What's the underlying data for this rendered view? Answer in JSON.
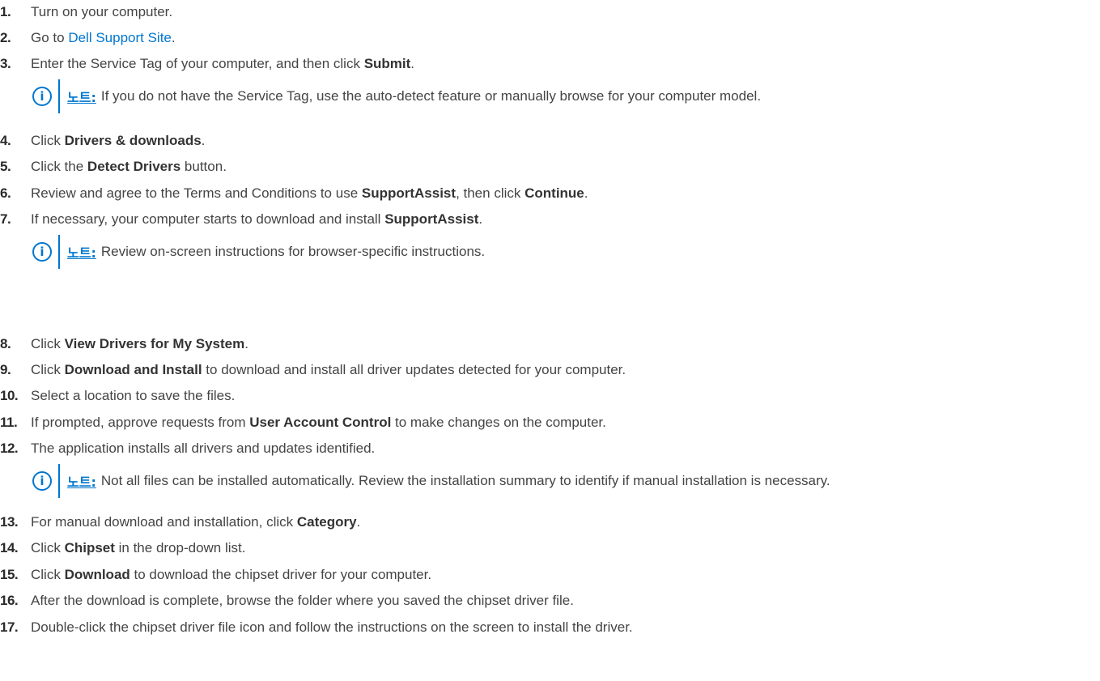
{
  "steps": {
    "s1": {
      "num": "1.",
      "text": "Turn on your computer."
    },
    "s2": {
      "num": "2.",
      "pre": "Go to ",
      "link": "Dell Support Site",
      "post": "."
    },
    "s3": {
      "num": "3.",
      "pre": "Enter the Service Tag of your computer, and then click ",
      "bold": "Submit",
      "post": "."
    },
    "s4": {
      "num": "4.",
      "pre": "Click ",
      "bold": "Drivers & downloads",
      "post": "."
    },
    "s5": {
      "num": "5.",
      "pre": "Click the ",
      "bold": "Detect Drivers",
      "post": " button."
    },
    "s6": {
      "num": "6.",
      "pre": "Review and agree to the Terms and Conditions to use ",
      "bold": "SupportAssist",
      "mid": ", then click ",
      "bold2": "Continue",
      "post": "."
    },
    "s7": {
      "num": "7.",
      "pre": "If necessary, your computer starts to download and install ",
      "bold": "SupportAssist",
      "post": "."
    },
    "s8": {
      "num": "8.",
      "pre": "Click ",
      "bold": "View Drivers for My System",
      "post": "."
    },
    "s9": {
      "num": "9.",
      "pre": "Click ",
      "bold": "Download and Install",
      "post": " to download and install all driver updates detected for your computer."
    },
    "s10": {
      "num": "10.",
      "text": "Select a location to save the files."
    },
    "s11": {
      "num": "11.",
      "pre": "If prompted, approve requests from ",
      "bold": "User Account Control",
      "post": " to make changes on the computer."
    },
    "s12": {
      "num": "12.",
      "text": "The application installs all drivers and updates identified."
    },
    "s13": {
      "num": "13.",
      "pre": "For manual download and installation, click ",
      "bold": "Category",
      "post": "."
    },
    "s14": {
      "num": "14.",
      "pre": "Click ",
      "bold": "Chipset",
      "post": " in the drop-down list."
    },
    "s15": {
      "num": "15.",
      "pre": "Click ",
      "bold": "Download",
      "post": " to download the chipset driver for your computer."
    },
    "s16": {
      "num": "16.",
      "text": "After the download is complete, browse the folder where you saved the chipset driver file."
    },
    "s17": {
      "num": "17.",
      "text": "Double-click the chipset driver file icon and follow the instructions on the screen to install the driver."
    }
  },
  "notes": {
    "label": "노트:",
    "n1": "If you do not have the Service Tag, use the auto-detect feature or manually browse for your computer model.",
    "n2": "Review on-screen instructions for browser-specific instructions.",
    "n3": "Not all files can be installed automatically. Review the installation summary to identify if manual installation is necessary."
  },
  "icons": {
    "note_icon": "info-circle-icon",
    "accent_color": "#0076ce"
  }
}
